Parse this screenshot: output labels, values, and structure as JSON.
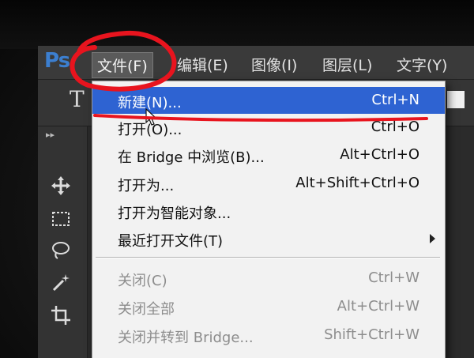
{
  "app": {
    "logo_text": "Ps"
  },
  "menubar": {
    "items": [
      {
        "label": "文件(F)"
      },
      {
        "label": "编辑(E)"
      },
      {
        "label": "图像(I)"
      },
      {
        "label": "图层(L)"
      },
      {
        "label": "文字(Y)"
      }
    ],
    "open_menu": "文件(F)"
  },
  "options_bar": {
    "tool_glyph": "T",
    "color_swatch": "#f0f0f0"
  },
  "toolbar": {
    "collapse_glyph": "▸▸",
    "tools": [
      {
        "name": "move-tool-icon"
      },
      {
        "name": "marquee-tool-icon"
      },
      {
        "name": "lasso-tool-icon"
      },
      {
        "name": "magic-wand-tool-icon"
      },
      {
        "name": "crop-tool-icon"
      }
    ]
  },
  "file_menu": {
    "items": [
      {
        "label": "新建(N)...",
        "shortcut": "Ctrl+N",
        "state": "highlighted"
      },
      {
        "label": "打开(O)...",
        "shortcut": "Ctrl+O",
        "state": "enabled"
      },
      {
        "label": "在 Bridge 中浏览(B)...",
        "shortcut": "Alt+Ctrl+O",
        "state": "enabled"
      },
      {
        "label": "打开为...",
        "shortcut": "Alt+Shift+Ctrl+O",
        "state": "enabled"
      },
      {
        "label": "打开为智能对象...",
        "shortcut": "",
        "state": "enabled"
      },
      {
        "label": "最近打开文件(T)",
        "shortcut": "",
        "state": "enabled",
        "submenu": true
      },
      {
        "label": "关闭(C)",
        "shortcut": "Ctrl+W",
        "state": "disabled"
      },
      {
        "label": "关闭全部",
        "shortcut": "Alt+Ctrl+W",
        "state": "disabled"
      },
      {
        "label": "关闭并转到 Bridge...",
        "shortcut": "Shift+Ctrl+W",
        "state": "disabled"
      }
    ]
  },
  "colors": {
    "highlight": "#2e63d2",
    "annotation_red": "#e8141e",
    "menu_background": "#f2f2f2",
    "disabled_text": "#8d8d8d"
  }
}
